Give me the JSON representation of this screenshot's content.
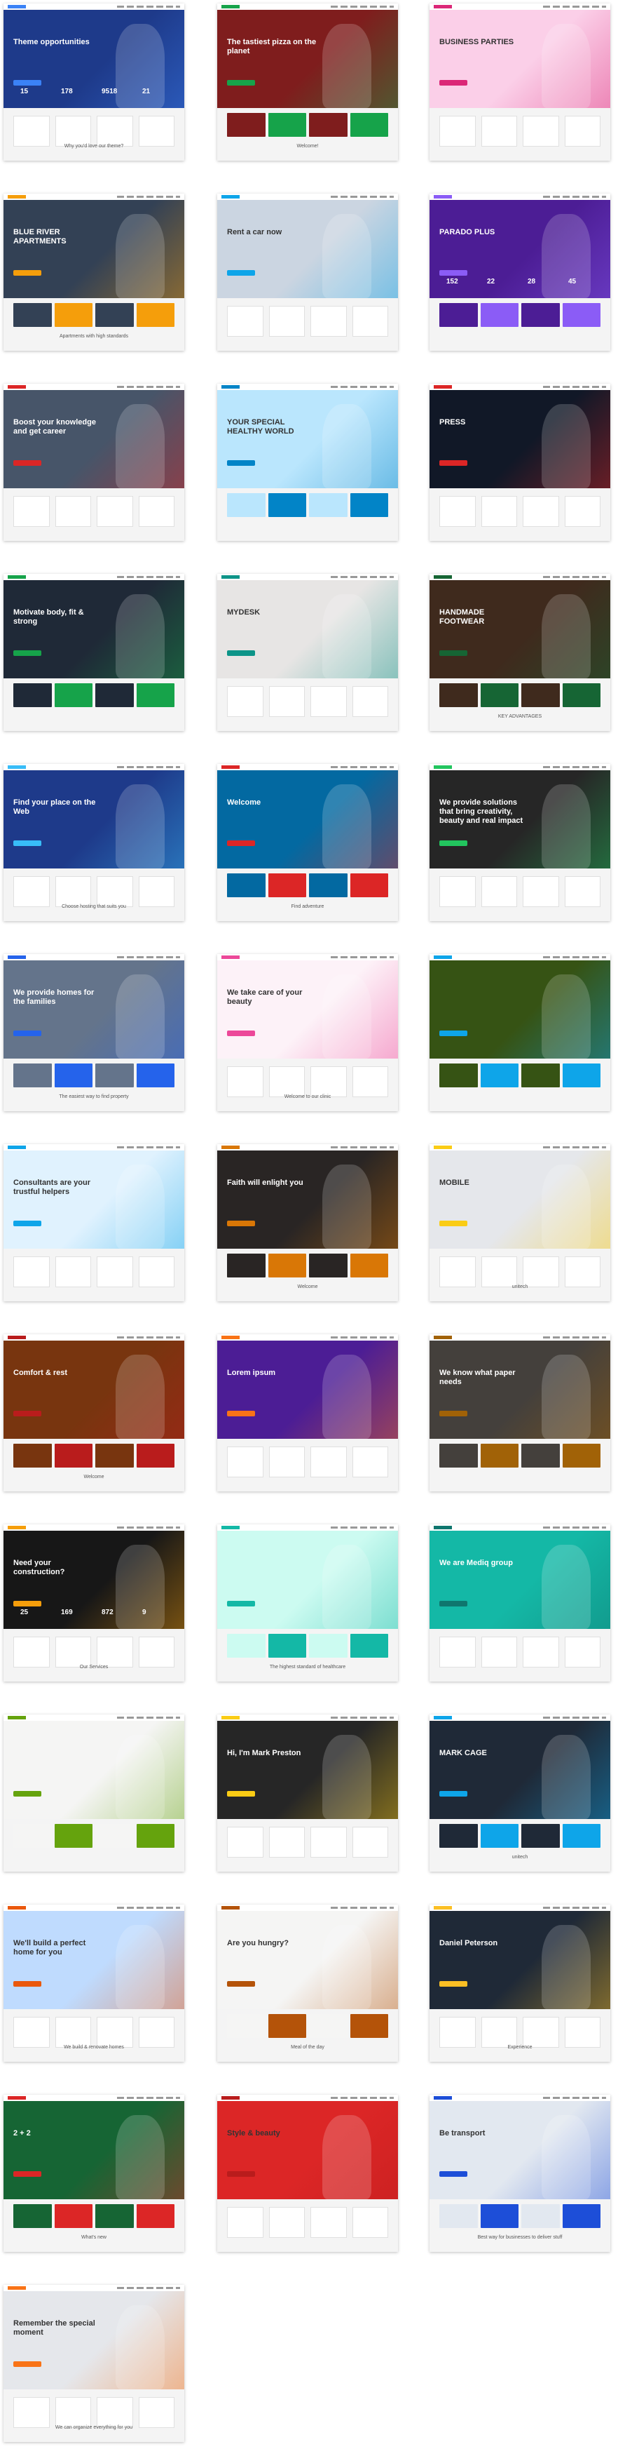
{
  "templates": [
    {
      "id": "it-services",
      "headline": "Theme opportunities",
      "footer": "Why you'd love our theme?",
      "stats": [
        "15",
        "178",
        "9518",
        "21"
      ],
      "hero": "#1e3a8a",
      "accent": "#3b82f6"
    },
    {
      "id": "pizzeria",
      "headline": "The tastiest pizza on the planet",
      "footer": "Welcome!",
      "hero": "#7f1d1d",
      "accent": "#16a34a"
    },
    {
      "id": "business-parties",
      "headline": "BUSINESS PARTIES",
      "footer": "",
      "hero": "#fbcfe8",
      "accent": "#db2777"
    },
    {
      "id": "real-estate-amsterdam",
      "headline": "BLUE RIVER APARTMENTS",
      "footer": "Apartments with high standards",
      "hero": "#334155",
      "accent": "#f59e0b"
    },
    {
      "id": "car-rental",
      "headline": "Rent a car now",
      "footer": "",
      "hero": "#cbd5e1",
      "accent": "#0ea5e9"
    },
    {
      "id": "night-club",
      "headline": "PARADO PLUS",
      "footer": "",
      "stats": [
        "152",
        "22",
        "28",
        "45"
      ],
      "hero": "#4c1d95",
      "accent": "#8b5cf6"
    },
    {
      "id": "education",
      "headline": "Boost your knowledge and get career",
      "footer": "",
      "hero": "#475569",
      "accent": "#dc2626"
    },
    {
      "id": "spa",
      "headline": "YOUR SPECIAL HEALTHY WORLD",
      "footer": "",
      "hero": "#bae6fd",
      "accent": "#0284c7"
    },
    {
      "id": "press",
      "headline": "PRESS",
      "footer": "",
      "hero": "#111827",
      "accent": "#dc2626"
    },
    {
      "id": "fitness",
      "headline": "Motivate body, fit & strong",
      "footer": "",
      "hero": "#1f2937",
      "accent": "#16a34a"
    },
    {
      "id": "mydesk",
      "headline": "MYDESK",
      "footer": "",
      "hero": "#e7e5e4",
      "accent": "#0d9488"
    },
    {
      "id": "shoes",
      "headline": "HANDMADE FOOTWEAR",
      "footer": "KEY ADVANTAGES",
      "hero": "#3f2a1d",
      "accent": "#166534"
    },
    {
      "id": "hosting",
      "headline": "Find your place on the Web",
      "footer": "Choose hosting that suits you",
      "hero": "#1e3a8a",
      "accent": "#38bdf8"
    },
    {
      "id": "travel",
      "headline": "Welcome",
      "footer": "Find adventure",
      "hero": "#0369a1",
      "accent": "#dc2626"
    },
    {
      "id": "agency",
      "headline": "We provide solutions that bring creativity, beauty and real impact",
      "footer": "",
      "hero": "#262626",
      "accent": "#22c55e"
    },
    {
      "id": "property",
      "headline": "We provide homes for the families",
      "footer": "The easiest way to find property",
      "hero": "#64748b",
      "accent": "#2563eb"
    },
    {
      "id": "beauty-clinic",
      "headline": "We take care of your beauty",
      "footer": "Welcome to our clinic",
      "hero": "#fdf2f8",
      "accent": "#ec4899"
    },
    {
      "id": "magazine",
      "headline": "",
      "footer": "",
      "hero": "#365314",
      "accent": "#0ea5e9"
    },
    {
      "id": "consulting",
      "headline": "Consultants are your trustful helpers",
      "footer": "",
      "hero": "#e0f2fe",
      "accent": "#0ea5e9"
    },
    {
      "id": "church",
      "headline": "Faith will enlight you",
      "footer": "Welcome",
      "hero": "#292524",
      "accent": "#d97706"
    },
    {
      "id": "portfolio-unitech",
      "headline": "MOBILE",
      "footer": "unitech",
      "hero": "#e5e7eb",
      "accent": "#facc15"
    },
    {
      "id": "hotel",
      "headline": "Comfort & rest",
      "footer": "Welcome",
      "hero": "#78350f",
      "accent": "#b91c1c"
    },
    {
      "id": "app",
      "headline": "Lorem ipsum",
      "footer": "",
      "hero": "#4c1d95",
      "accent": "#f97316"
    },
    {
      "id": "paper-mill",
      "headline": "We know what paper needs",
      "footer": "",
      "hero": "#44403c",
      "accent": "#a16207"
    },
    {
      "id": "construction",
      "headline": "Need your construction?",
      "footer": "Our Services",
      "stats": [
        "25",
        "169",
        "872",
        "9"
      ],
      "hero": "#171717",
      "accent": "#f59e0b"
    },
    {
      "id": "healthcare",
      "headline": "",
      "footer": "The highest standard of healthcare",
      "hero": "#ccfbf1",
      "accent": "#14b8a6"
    },
    {
      "id": "people",
      "headline": "We are Mediq group",
      "footer": "",
      "hero": "#14b8a6",
      "accent": "#0f766e"
    },
    {
      "id": "eco",
      "headline": "",
      "footer": "",
      "hero": "#f5f5f4",
      "accent": "#65a30d"
    },
    {
      "id": "cv",
      "headline": "Hi, I'm Mark Preston",
      "footer": "",
      "hero": "#262626",
      "accent": "#facc15"
    },
    {
      "id": "photographer",
      "headline": "MARK CAGE",
      "footer": "unitech",
      "hero": "#1f2937",
      "accent": "#0ea5e9"
    },
    {
      "id": "builders",
      "headline": "We'll build a perfect home for you",
      "footer": "We build & renovate homes",
      "hero": "#bfdbfe",
      "accent": "#ea580c"
    },
    {
      "id": "restaurant",
      "headline": "Are you hungry?",
      "footer": "Meal of the day",
      "hero": "#f5f5f4",
      "accent": "#b45309"
    },
    {
      "id": "resume",
      "headline": "Daniel Peterson",
      "footer": "Experience",
      "hero": "#1f2937",
      "accent": "#fbbf24"
    },
    {
      "id": "school",
      "headline": "2 + 2",
      "footer": "What's new",
      "hero": "#166534",
      "accent": "#dc2626"
    },
    {
      "id": "style-beauty",
      "headline": "Style & beauty",
      "footer": "",
      "hero": "#dc2626",
      "accent": "#b91c1c"
    },
    {
      "id": "transport",
      "headline": "Be transport",
      "footer": "Best way for businesses to deliver stuff",
      "hero": "#e2e8f0",
      "accent": "#1d4ed8"
    },
    {
      "id": "wedding",
      "headline": "Remember the special moment",
      "footer": "We can organize everything for you",
      "hero": "#e5e7eb",
      "accent": "#f97316"
    }
  ]
}
